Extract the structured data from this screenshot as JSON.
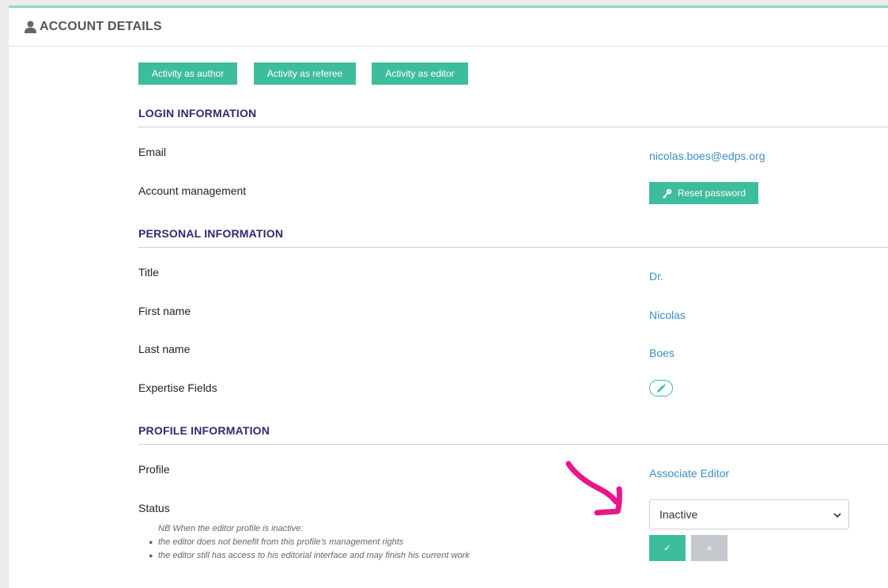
{
  "header": {
    "title": "ACCOUNT DETAILS",
    "icon": "user-icon"
  },
  "activity_buttons": [
    {
      "label": "Activity as author"
    },
    {
      "label": "Activity as referee"
    },
    {
      "label": "Activity as editor"
    }
  ],
  "login": {
    "title": "LOGIN INFORMATION",
    "email_label": "Email",
    "email_value": "nicolas.boes@edps.org",
    "account_label": "Account management",
    "reset_button": "Reset password"
  },
  "personal": {
    "title": "PERSONAL INFORMATION",
    "title_label": "Title",
    "title_value": "Dr.",
    "first_name_label": "First name",
    "first_name_value": "Nicolas",
    "last_name_label": "Last name",
    "last_name_value": "Boes",
    "expertise_label": "Expertise Fields"
  },
  "profile": {
    "title": "PROFILE INFORMATION",
    "profile_label": "Profile",
    "profile_value": "Associate Editor",
    "status_label": "Status",
    "status_selected": "Inactive",
    "note_heading": "NB When the editor profile is inactive:",
    "note_items": [
      "the editor does not benefit from this profile's management rights",
      "the editor still has access to his editorial interface and may finish his current work"
    ],
    "confirm_symbol": "✓",
    "cancel_symbol": "×"
  },
  "colors": {
    "accent": "#3ebd9c",
    "section_title": "#2e2c6e",
    "value_link": "#3a8fc4",
    "annotation_arrow": "#e8178a"
  }
}
